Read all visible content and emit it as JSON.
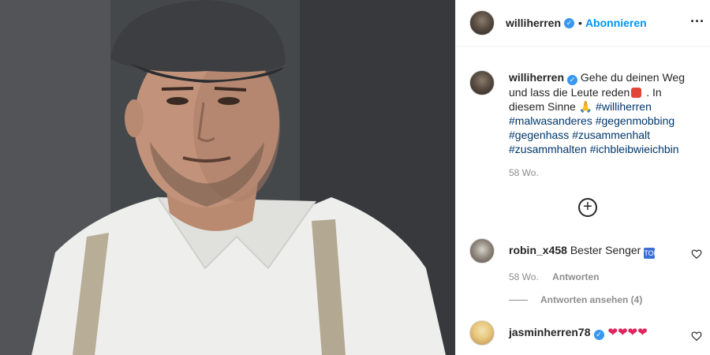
{
  "post": {
    "header": {
      "username": "williherren",
      "verified": true,
      "separator": "•",
      "follow_label": "Abonnieren",
      "more_icon": "more-horizontal-icon"
    },
    "caption": {
      "username": "williherren",
      "text_part1": " Gehe du deinen Weg und lass die Leute reden",
      "text_part2": " . In diesem Sinne ",
      "emoji_hands": "🙏",
      "hashtags": [
        "#williherren",
        "#malwasanderes",
        "#gegenmobbing",
        "#gegenhass",
        "#zusammenhalt",
        "#zusammhalten",
        "#ichbleibwieichbin"
      ],
      "time": "58 Wo."
    },
    "load_more_icon": "plus-circle-icon",
    "comments": [
      {
        "username": "robin_x458",
        "text": "Bester Senger",
        "emoji": "🔝",
        "time": "58 Wo.",
        "reply_label": "Antworten",
        "view_replies_label": "Antworten ansehen (4)"
      },
      {
        "username": "jasminherren78",
        "verified": true,
        "text": "❤❤❤❤"
      }
    ],
    "colors": {
      "accent": "#0095f6",
      "verified": "#3897f0",
      "hashtag": "#00376b",
      "muted": "#8e8e8e"
    }
  }
}
